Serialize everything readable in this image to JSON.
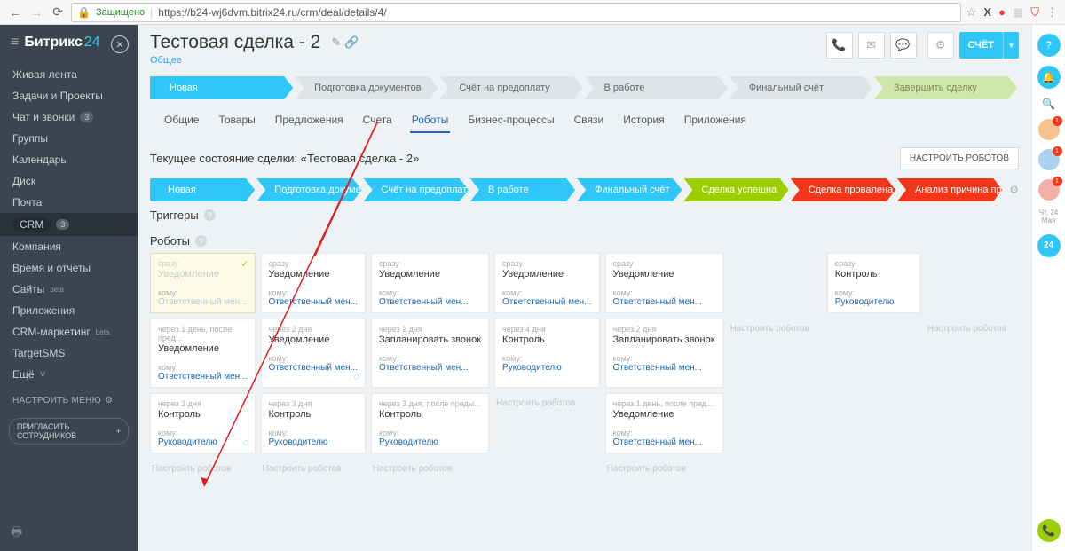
{
  "chrome": {
    "secure": "Защищено",
    "url": "https://b24-wj6dvm.bitrix24.ru/crm/deal/details/4/"
  },
  "sidebar": {
    "brand": "Битрикс",
    "brand_num": "24",
    "items": [
      "Живая лента",
      "Задачи и Проекты",
      "Чат и звонки",
      "Группы",
      "Календарь",
      "Диск",
      "Почта",
      "CRM",
      "Компания",
      "Время и отчеты",
      "Сайты",
      "Приложения",
      "CRM-маркетинг",
      "TargetSMS",
      "Ещё"
    ],
    "chat_badge": "3",
    "crm_badge": "3",
    "configure": "настроить меню",
    "invite": "пригласить сотрудников"
  },
  "header": {
    "title": "Тестовая сделка - 2",
    "breadcrumb": "Общее",
    "acct_button": "СЧЁТ"
  },
  "stages": [
    "Новая",
    "Подготовка документов",
    "Счёт на предоплату",
    "В работе",
    "Финальный счёт",
    "Завершить сделку"
  ],
  "tabs": [
    "Общие",
    "Товары",
    "Предложения",
    "Счета",
    "Роботы",
    "Бизнес-процессы",
    "Связи",
    "История",
    "Приложения"
  ],
  "active_tab": 4,
  "state_text": "Текущее состояние сделки: «Тестовая сделка - 2»",
  "config_btn": "НАСТРОИТЬ РОБОТОВ",
  "robot_stages": [
    {
      "label": "Новая",
      "cls": "blue"
    },
    {
      "label": "Подготовка документ...",
      "cls": "blue"
    },
    {
      "label": "Счёт на предоплату",
      "cls": "blue"
    },
    {
      "label": "В работе",
      "cls": "blue"
    },
    {
      "label": "Финальный счёт",
      "cls": "blue"
    },
    {
      "label": "Сделка успешна",
      "cls": "green"
    },
    {
      "label": "Сделка провалена",
      "cls": "red"
    },
    {
      "label": "Анализ причина пр...",
      "cls": "red"
    }
  ],
  "triggers_label": "Триггеры",
  "robots_label": "Роботы",
  "placeholder": "Настроить роботов",
  "to_label": "кому:",
  "recip": {
    "resp": "Ответственный мен...",
    "mgr": "Руководителю"
  },
  "when": {
    "now": "сразу",
    "d1": "через 1 день, после пред...",
    "d2": "через 2 дня",
    "d3": "через 3 дня",
    "d4": "через 4 дня",
    "d3after": "через 3 дня, после преды...",
    "d1after": "через 1 день, после пред..."
  },
  "act": {
    "notify": "Уведомление",
    "control": "Контроль",
    "call": "Запланировать звонок"
  },
  "grid": [
    [
      {
        "when": "now",
        "action": "notify",
        "to": "resp",
        "yellow": true,
        "check": true,
        "dim": true
      },
      {
        "when": "now",
        "action": "notify",
        "to": "resp"
      },
      {
        "when": "now",
        "action": "notify",
        "to": "resp"
      },
      {
        "when": "now",
        "action": "notify",
        "to": "resp"
      },
      {
        "when": "now",
        "action": "notify",
        "to": "resp"
      },
      null,
      {
        "when": "now",
        "action": "control",
        "to": "mgr"
      },
      null
    ],
    [
      {
        "when": "d1",
        "action": "notify",
        "to": "resp"
      },
      {
        "when": "d2",
        "action": "notify",
        "to": "resp",
        "spinner": true
      },
      {
        "when": "d2",
        "action": "call",
        "to": "resp"
      },
      {
        "when": "d4",
        "action": "control",
        "to": "mgr"
      },
      {
        "when": "d2",
        "action": "call",
        "to": "resp"
      },
      "ph",
      null,
      "ph"
    ],
    [
      {
        "when": "d3",
        "action": "control",
        "to": "mgr",
        "spinner": true
      },
      {
        "when": "d3",
        "action": "control",
        "to": "mgr"
      },
      {
        "when": "d3after",
        "action": "control",
        "to": "mgr"
      },
      "ph",
      {
        "when": "d1after",
        "action": "notify",
        "to": "resp"
      },
      null,
      null,
      null
    ],
    [
      "ph",
      "ph",
      "ph",
      null,
      "ph",
      null,
      null,
      null
    ]
  ],
  "rail": {
    "date": "Чт, 24 Мая",
    "big": "24",
    "badges": [
      "1",
      "1",
      "1"
    ]
  }
}
